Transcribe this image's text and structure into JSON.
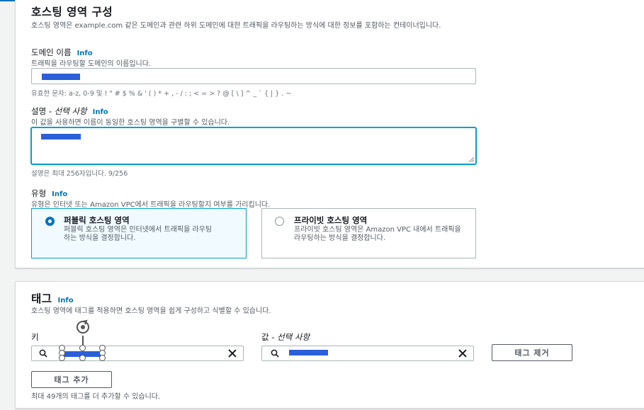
{
  "hosted_zone": {
    "heading": "호스팅 영역 구성",
    "description": "호스팅 영역은 example.com 같은 도메인과 관련 하위 도메인에 대한 트래픽을 라우팅하는 방식에 대한 정보를 포함하는 컨테이너입니다.",
    "domain": {
      "label": "도메인 이름",
      "info": "Info",
      "description": "트래픽을 라우팅할 도메인의 이름입니다.",
      "constraint": "유효한 문자: a-z, 0-9 및 ! \" # $ % & ' ( ) * + , - / : ; < = > ? @ [ \\ ] ^ _ ` { | } . ~"
    },
    "comment": {
      "label": "설명 - ",
      "optional": "선택 사항",
      "info": "Info",
      "description": "이 값을 사용하면 이름이 동일한 호스팅 영역을 구별할 수 있습니다.",
      "constraint": "설명은 최대 256자입니다. 9/256"
    },
    "type": {
      "label": "유형",
      "info": "Info",
      "description": "유형은 인터넷 또는 Amazon VPC에서 트래픽을 라우팅할지 여부를 가리킵니다.",
      "options": [
        {
          "title": "퍼블릭 호스팅 영역",
          "description": "퍼블릭 호스팅 영역은 인터넷에서 트래픽을 라우팅하는 방식을 결정합니다.",
          "selected": true
        },
        {
          "title": "프라이빗 호스팅 영역",
          "description": "프라이빗 호스팅 영역은 Amazon VPC 내에서 트래픽을 라우팅하는 방식을 결정합니다.",
          "selected": false
        }
      ]
    }
  },
  "tags": {
    "heading": "태그",
    "info": "Info",
    "description": "호스팅 영역에 태그를 적용하면 호스팅 영역을 쉽게 구성하고 식별할 수 있습니다.",
    "key_label": "키",
    "value_label": "값 - ",
    "value_optional": "선택 사항",
    "remove_button": "태그 제거",
    "add_button": "태그 추가",
    "limit_text": "최대 49개의 태그를 더 추가할 수 있습니다."
  },
  "colors": {
    "accent": "#0073bb",
    "focus": "#00a1c9",
    "redaction": "#2b5fd9"
  }
}
